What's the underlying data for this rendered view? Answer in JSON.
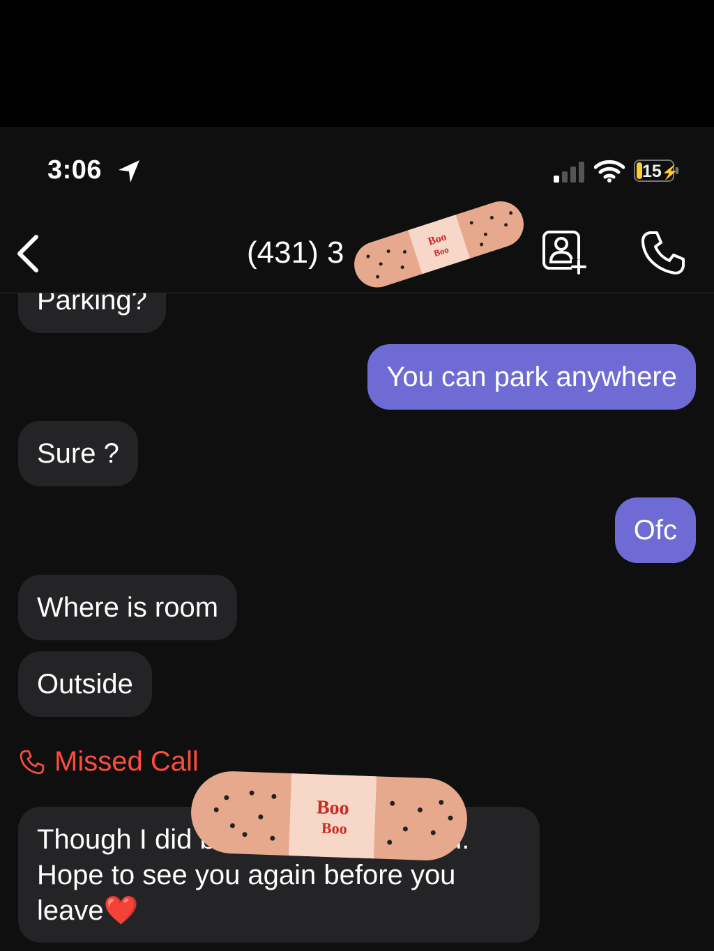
{
  "status_bar": {
    "time": "3:06",
    "battery": "15"
  },
  "header": {
    "title": "(431) 3"
  },
  "messages": [
    {
      "direction": "in",
      "text": "Parking?"
    },
    {
      "direction": "out",
      "text": "You can park anywhere"
    },
    {
      "direction": "in",
      "text": "Sure ?"
    },
    {
      "direction": "out",
      "text": "Ofc"
    },
    {
      "direction": "in",
      "text": "Where is room"
    },
    {
      "direction": "in",
      "text": "Outside"
    },
    {
      "direction": "in",
      "text": "Though I did          but it was really good. Hope to see you again before you leave❤️"
    }
  ],
  "missed_call": {
    "label": "Missed Call"
  },
  "stickers": {
    "text_line1": "Boo",
    "text_line2": "Boo"
  },
  "colors": {
    "outgoing_bubble": "#6e6bd5",
    "incoming_bubble": "#242426",
    "missed_call": "#ff4b3e",
    "background": "#0f0f10"
  }
}
